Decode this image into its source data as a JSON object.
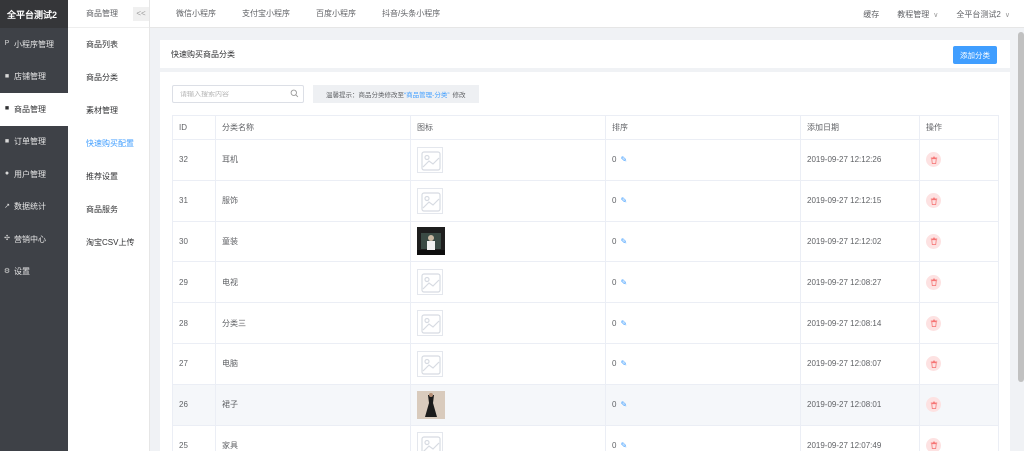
{
  "brand": "全平台测试2",
  "sidebar": {
    "items": [
      {
        "label": "小程序管理",
        "icon": "p-icon",
        "glyph": "P"
      },
      {
        "label": "店铺管理",
        "icon": "store-icon",
        "glyph": "■"
      },
      {
        "label": "商品管理",
        "icon": "goods-icon",
        "glyph": "■",
        "active": true
      },
      {
        "label": "订单管理",
        "icon": "order-icon",
        "glyph": "■"
      },
      {
        "label": "用户管理",
        "icon": "user-icon",
        "glyph": "●"
      },
      {
        "label": "数据统计",
        "icon": "stats-icon",
        "glyph": "↗"
      },
      {
        "label": "营销中心",
        "icon": "marketing-icon",
        "glyph": "✣"
      },
      {
        "label": "设置",
        "icon": "settings-icon",
        "glyph": "⚙"
      }
    ]
  },
  "submenu": {
    "title": "商品管理",
    "collapse": "<<",
    "items": [
      {
        "label": "商品列表"
      },
      {
        "label": "商品分类"
      },
      {
        "label": "素材管理"
      },
      {
        "label": "快速购买配置",
        "active": true
      },
      {
        "label": "推荐设置"
      },
      {
        "label": "商品服务"
      },
      {
        "label": "淘宝CSV上传"
      }
    ]
  },
  "topbar": {
    "tabs": [
      "微信小程序",
      "支付宝小程序",
      "百度小程序",
      "抖音/头条小程序"
    ],
    "cache": "缓存",
    "tutorial": "教程管理",
    "account": "全平台测试2"
  },
  "page": {
    "title": "快速购买商品分类",
    "add_button": "添加分类",
    "search_placeholder": "请输入搜索内容",
    "tip_prefix": "温馨提示：商品分类修改至",
    "tip_link": "“商品管理-分类”",
    "tip_suffix": "修改"
  },
  "table": {
    "columns": [
      "ID",
      "分类名称",
      "图标",
      "排序",
      "添加日期",
      "操作"
    ],
    "rows": [
      {
        "id": "32",
        "name": "耳机",
        "image": "placeholder",
        "sort": "0",
        "date": "2019-09-27 12:12:26"
      },
      {
        "id": "31",
        "name": "服饰",
        "image": "placeholder",
        "sort": "0",
        "date": "2019-09-27 12:12:15"
      },
      {
        "id": "30",
        "name": "童装",
        "image": "photo-dark",
        "sort": "0",
        "date": "2019-09-27 12:12:02"
      },
      {
        "id": "29",
        "name": "电视",
        "image": "placeholder",
        "sort": "0",
        "date": "2019-09-27 12:08:27"
      },
      {
        "id": "28",
        "name": "分类三",
        "image": "placeholder",
        "sort": "0",
        "date": "2019-09-27 12:08:14"
      },
      {
        "id": "27",
        "name": "电脑",
        "image": "placeholder",
        "sort": "0",
        "date": "2019-09-27 12:08:07"
      },
      {
        "id": "26",
        "name": "裙子",
        "image": "photo-dress",
        "sort": "0",
        "date": "2019-09-27 12:08:01",
        "highlight": true
      },
      {
        "id": "25",
        "name": "家具",
        "image": "placeholder",
        "sort": "0",
        "date": "2019-09-27 12:07:49"
      }
    ]
  },
  "colors": {
    "accent": "#409eff",
    "sidebar_bg": "#3e4147",
    "danger_bg": "#fde2e2",
    "danger": "#f56c6c"
  }
}
